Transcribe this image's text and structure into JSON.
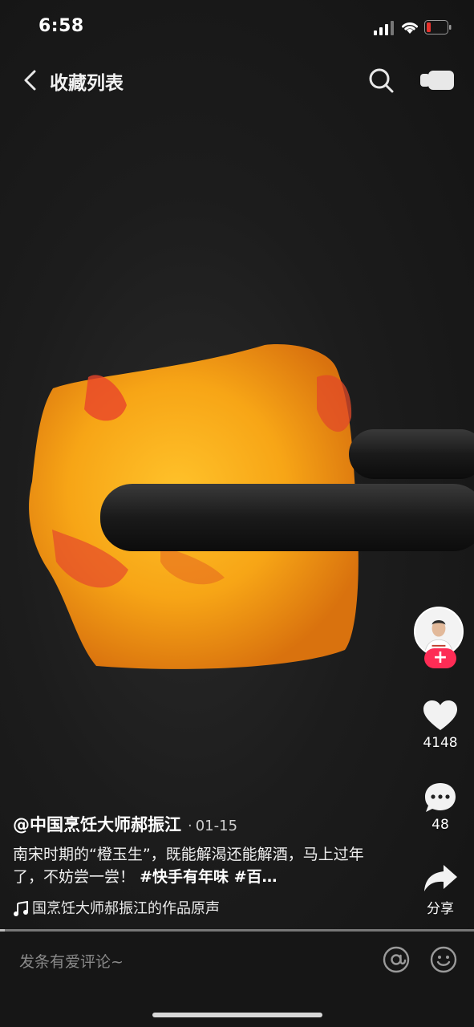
{
  "status_bar": {
    "time": "6:58",
    "battery_color": "#e8322d"
  },
  "nav": {
    "title": "收藏列表",
    "back_icon": "chevron-left-icon",
    "search_icon": "search-icon",
    "camera_icon": "video-camera-icon"
  },
  "video": {
    "author": "@中国烹饪大师郝振江",
    "separator": "·",
    "date": "01-15",
    "caption_text": "南宋时期的“橙玉生”，既能解渴还能解酒，马上过年了，不妨尝一尝！",
    "caption_tags": "#快手有年味 #百…",
    "music": "国烹饪大师郝振江的作品原声",
    "progress_fraction": 0.01
  },
  "actions": {
    "follow_label": "+",
    "like_count": "4148",
    "comment_count": "48",
    "share_label": "分享",
    "accent": "#fe2c55"
  },
  "comment_bar": {
    "placeholder": "发条有爱评论~",
    "at_icon": "at-icon",
    "emoji_icon": "emoji-icon"
  }
}
